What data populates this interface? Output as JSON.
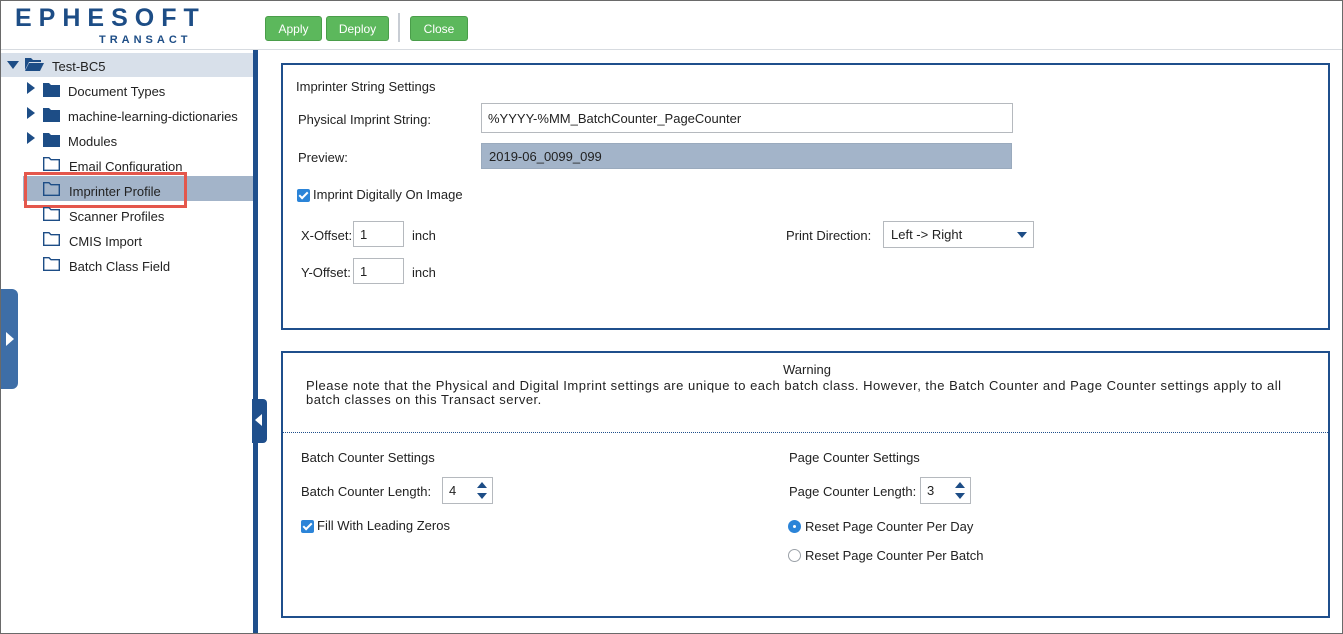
{
  "logo": {
    "main": "EPHESOFT",
    "sub": "TRANSACT"
  },
  "toolbar": {
    "apply": "Apply",
    "deploy": "Deploy",
    "close": "Close"
  },
  "tree": {
    "root": "Test-BC5",
    "items": [
      {
        "label": "Document Types"
      },
      {
        "label": "machine-learning-dictionaries"
      },
      {
        "label": "Modules"
      },
      {
        "label": "Email Configuration"
      },
      {
        "label": "Imprinter Profile"
      },
      {
        "label": "Scanner Profiles"
      },
      {
        "label": "CMIS Import"
      },
      {
        "label": "Batch Class Field"
      }
    ]
  },
  "imprinter": {
    "title": "Imprinter String Settings",
    "physical_label": "Physical Imprint String:",
    "physical_value": "%YYYY-%MM_BatchCounter_PageCounter",
    "preview_label": "Preview:",
    "preview_value": "2019-06_0099_099",
    "imprint_digitally_label": "Imprint Digitally On Image",
    "imprint_digitally_checked": true,
    "x_offset_label": "X-Offset:",
    "x_offset_value": "1",
    "x_unit": "inch",
    "y_offset_label": "Y-Offset:",
    "y_offset_value": "1",
    "y_unit": "inch",
    "print_direction_label": "Print Direction:",
    "print_direction_value": "Left -> Right"
  },
  "warning": {
    "title": "Warning",
    "text": "Please note that the Physical and Digital Imprint settings are unique to each batch class. However, the Batch Counter and Page Counter settings apply to all batch classes on this Transact server."
  },
  "batch_counter": {
    "title": "Batch Counter Settings",
    "length_label": "Batch Counter Length:",
    "length_value": "4",
    "leading_zeros_label": "Fill With Leading Zeros",
    "leading_zeros_checked": true
  },
  "page_counter": {
    "title": "Page Counter Settings",
    "length_label": "Page Counter Length:",
    "length_value": "3",
    "reset_day_label": "Reset Page Counter Per Day",
    "reset_batch_label": "Reset Page Counter Per Batch",
    "selected": "per_day"
  },
  "colors": {
    "accent": "#1f4f8c",
    "button_green": "#5cb85c",
    "selection": "#a3b4c9",
    "highlight": "#e4574c"
  }
}
